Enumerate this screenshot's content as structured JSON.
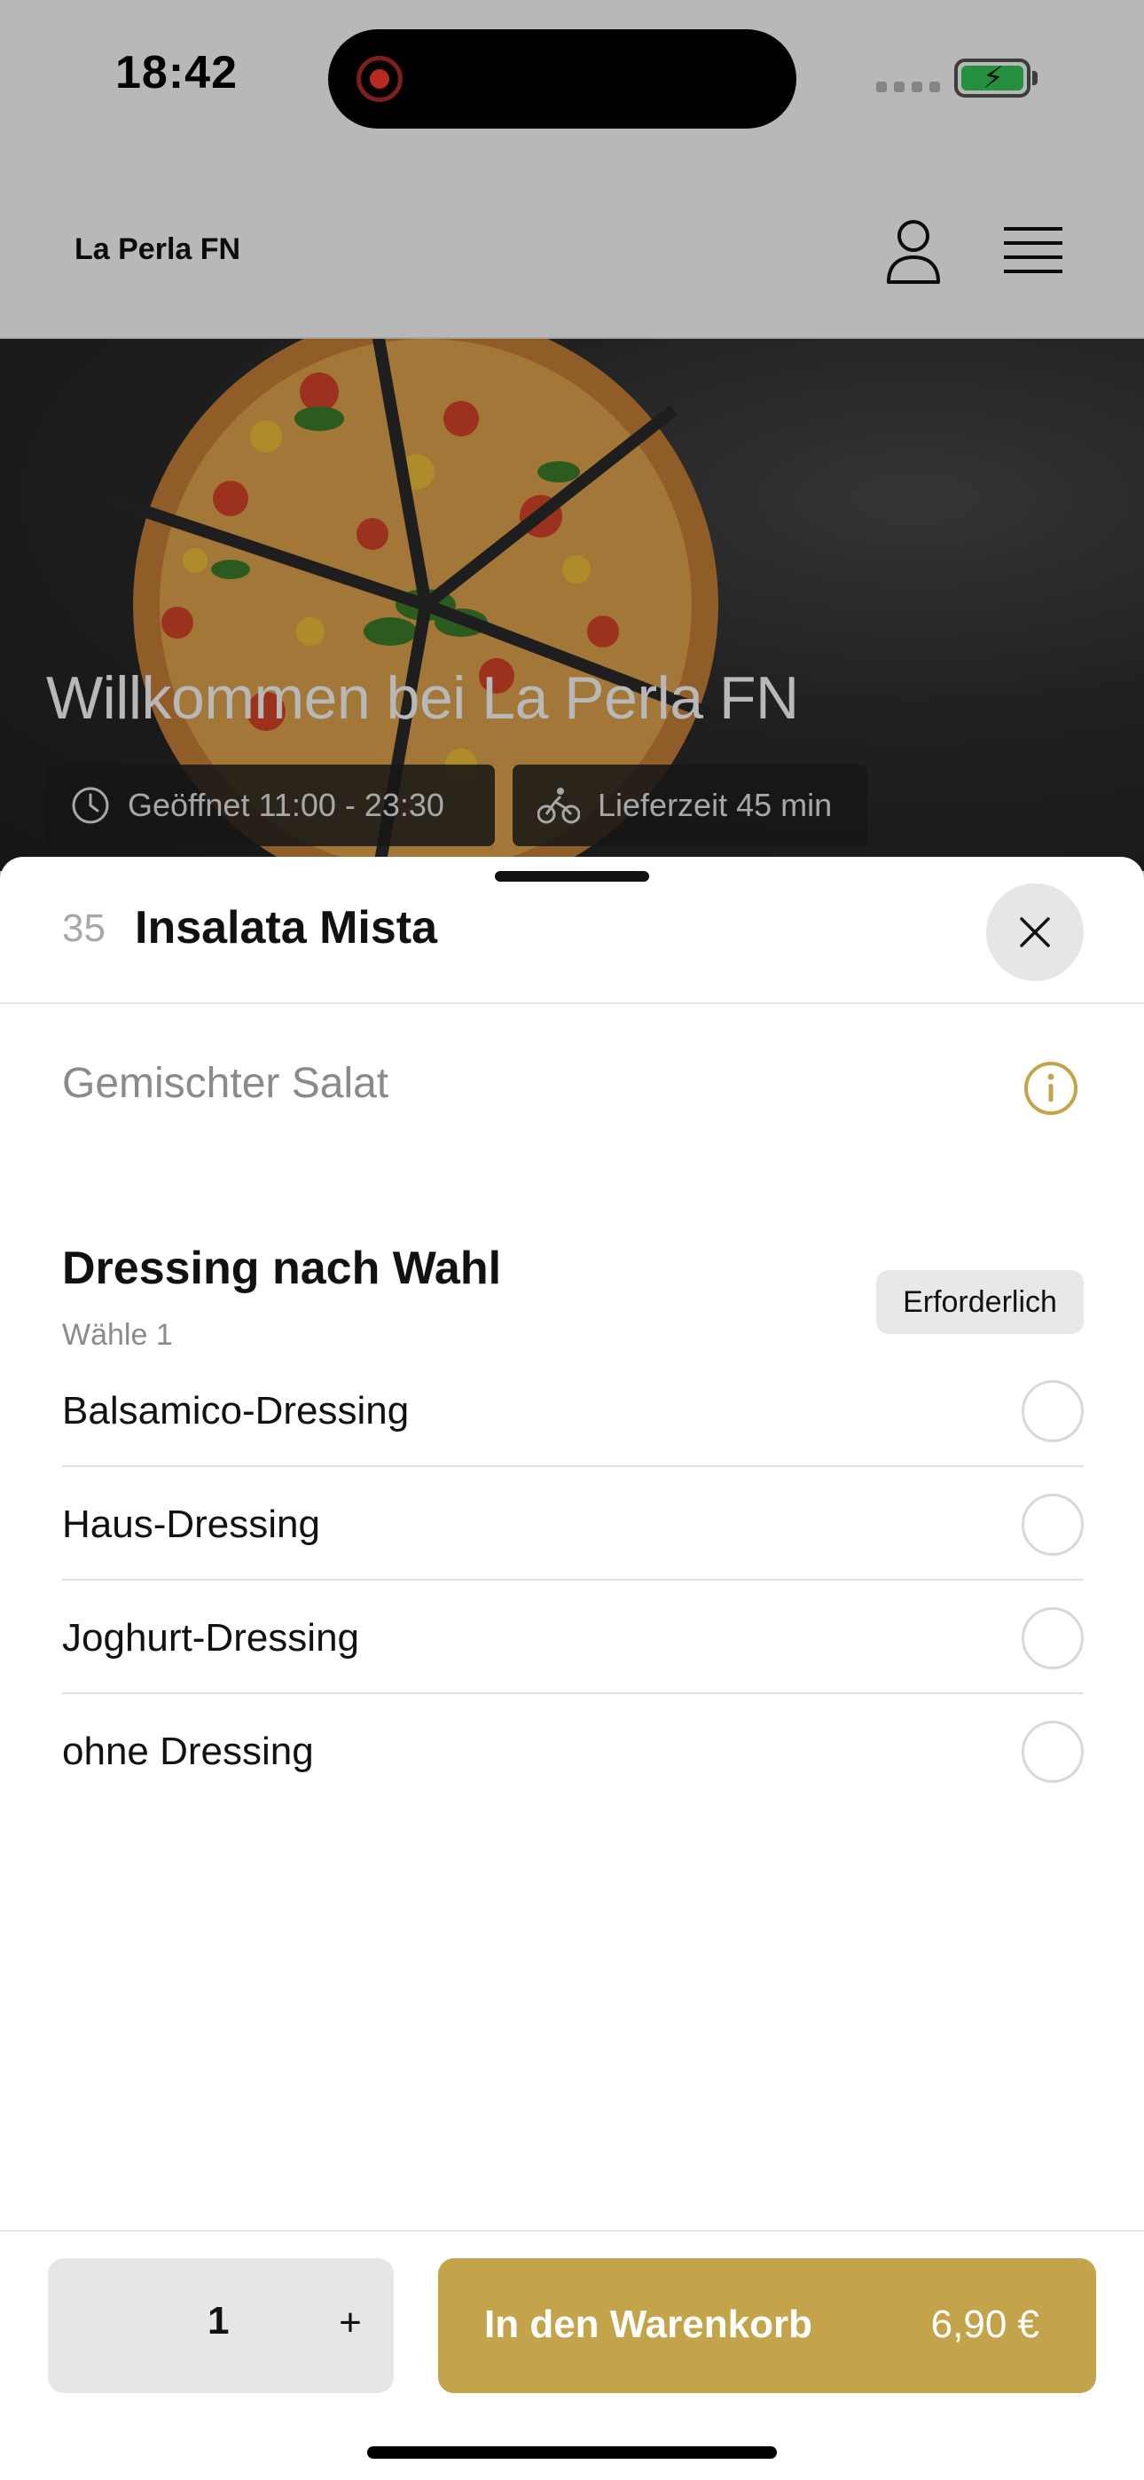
{
  "status_bar": {
    "time": "18:42"
  },
  "header": {
    "logo": "La Perla FN"
  },
  "hero": {
    "title": "Willkommen bei La Perla FN",
    "opening_hours": "Geöffnet 11:00 - 23:30",
    "delivery_time": "Lieferzeit 45 min"
  },
  "item": {
    "number": "35",
    "title": "Insalata Mista",
    "description": "Gemischter Salat"
  },
  "option_group": {
    "title": "Dressing nach Wahl",
    "subtitle": "Wähle 1",
    "badge": "Erforderlich",
    "options": [
      {
        "label": "Balsamico-Dressing",
        "selected": false
      },
      {
        "label": "Haus-Dressing",
        "selected": false
      },
      {
        "label": "Joghurt-Dressing",
        "selected": false
      },
      {
        "label": "ohne Dressing",
        "selected": false
      }
    ]
  },
  "footer": {
    "quantity": "1",
    "plus": "+",
    "cart_label": "In den Warenkorb",
    "price": "6,90 €"
  },
  "colors": {
    "accent": "#c3a44a",
    "overlay": "rgba(0,0,0,0.28)"
  }
}
